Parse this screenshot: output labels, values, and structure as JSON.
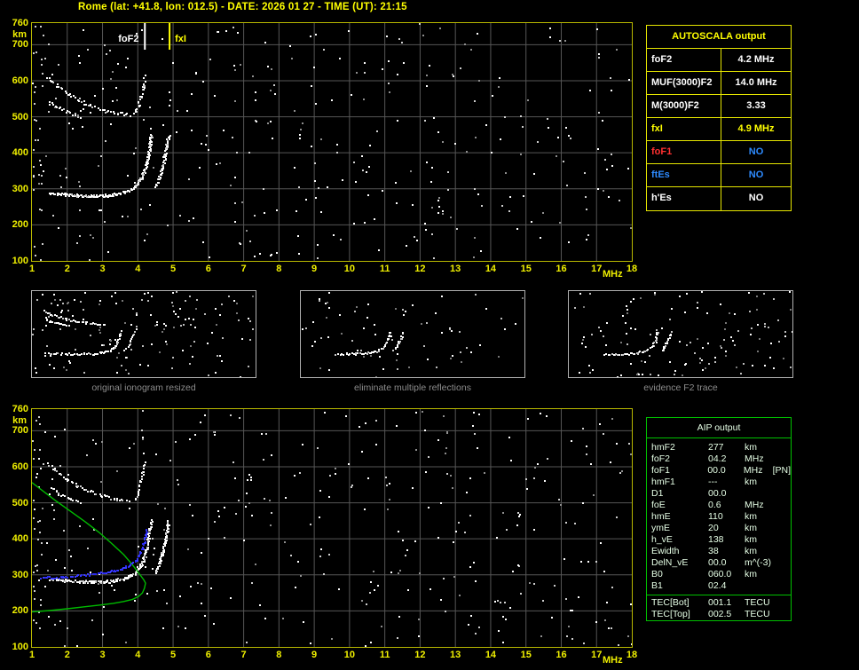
{
  "title": "Rome (lat: +41.8, lon: 012.5) - DATE: 2026 01 27 - TIME (UT): 21:15",
  "colors": {
    "background": "#000000",
    "title_text": "#ffff00",
    "plot_border": "#b8b800",
    "grid_line": "#565656",
    "axis_text": "#f0f000",
    "echo_trace": "#ffffff",
    "profile_green": "#00bb00",
    "restored_blue": "#3a3aff",
    "thumb_border": "#b0b0b0",
    "caption_text": "#8c8c8c",
    "autoscala_border": "#e6e600",
    "aip_border": "#00c000",
    "aip_text": "#e6ffe6"
  },
  "axis": {
    "y_ticks": [
      "760",
      "700",
      "600",
      "500",
      "400",
      "300",
      "200",
      "100"
    ],
    "y_unit": "km",
    "x_ticks": [
      "1",
      "2",
      "3",
      "4",
      "5",
      "6",
      "7",
      "8",
      "9",
      "10",
      "11",
      "12",
      "13",
      "14",
      "15",
      "16",
      "17",
      "18"
    ],
    "x_unit": "MHz"
  },
  "top_plot": {
    "markers": [
      {
        "label": "foF2",
        "freq": 4.2,
        "color": "#ffffff"
      },
      {
        "label": "fxI",
        "freq": 4.9,
        "color": "#ffff00"
      }
    ]
  },
  "autoscala_table": {
    "header": "AUTOSCALA output",
    "rows": [
      {
        "label": "foF2",
        "value": "4.2 MHz",
        "label_color": "#ffffff",
        "value_color": "#ffffff"
      },
      {
        "label": "MUF(3000)F2",
        "value": "14.0 MHz",
        "label_color": "#ffffff",
        "value_color": "#ffffff"
      },
      {
        "label": "M(3000)F2",
        "value": "3.33",
        "label_color": "#ffffff",
        "value_color": "#ffffff"
      },
      {
        "label": "fxI",
        "value": "4.9 MHz",
        "label_color": "#ffff00",
        "value_color": "#ffff00"
      },
      {
        "label": "foF1",
        "value": "NO",
        "label_color": "#ff3030",
        "value_color": "#2e8bff"
      },
      {
        "label": "ftEs",
        "value": "NO",
        "label_color": "#2e8bff",
        "value_color": "#2e8bff"
      },
      {
        "label": "h'Es",
        "value": "NO",
        "label_color": "#ffffff",
        "value_color": "#ffffff"
      }
    ]
  },
  "thumbnails": [
    {
      "caption": "original ionogram resized"
    },
    {
      "caption": "eliminate multiple reflections"
    },
    {
      "caption": "evidence F2 trace"
    }
  ],
  "aip_table": {
    "header": "AIP output",
    "rows": [
      {
        "label": "hmF2",
        "value": "277",
        "unit": "km",
        "extra": ""
      },
      {
        "label": "foF2",
        "value": "04.2",
        "unit": "MHz",
        "extra": ""
      },
      {
        "label": "foF1",
        "value": "00.0",
        "unit": "MHz",
        "extra": "[PN]"
      },
      {
        "label": "hmF1",
        "value": "---",
        "unit": "km",
        "extra": ""
      },
      {
        "label": "D1",
        "value": "00.0",
        "unit": "",
        "extra": ""
      },
      {
        "label": "foE",
        "value": "0.6",
        "unit": "MHz",
        "extra": ""
      },
      {
        "label": "hmE",
        "value": "110",
        "unit": "km",
        "extra": ""
      },
      {
        "label": "ymE",
        "value": "20",
        "unit": "km",
        "extra": ""
      },
      {
        "label": "h_vE",
        "value": "138",
        "unit": "km",
        "extra": ""
      },
      {
        "label": "Ewidth",
        "value": "38",
        "unit": "km",
        "extra": ""
      },
      {
        "label": "DelN_vE",
        "value": "00.0",
        "unit": "m^(-3)",
        "extra": ""
      },
      {
        "label": "B0",
        "value": "060.0",
        "unit": "km",
        "extra": ""
      },
      {
        "label": "B1",
        "value": "02.4",
        "unit": "",
        "extra": ""
      }
    ],
    "tec_rows": [
      {
        "label": "TEC[Bot]",
        "value": "001.1",
        "unit": "TECU",
        "extra": ""
      },
      {
        "label": "TEC[Top]",
        "value": "002.5",
        "unit": "TECU",
        "extra": ""
      }
    ]
  },
  "chart_data": {
    "type": "scatter",
    "xlabel": "MHz",
    "ylabel": "km",
    "x_range": [
      1,
      18
    ],
    "y_range": [
      100,
      760
    ],
    "key_values": {
      "foF2_MHz": 4.2,
      "fxI_MHz": 4.9,
      "MUF3000F2_MHz": 14.0,
      "M3000F2": 3.33,
      "hmF2_km": 277,
      "foE_MHz": 0.6,
      "hmE_km": 110,
      "B0_km": 60.0,
      "B1": 2.4,
      "TEC_bot_TECU": 1.1,
      "TEC_top_TECU": 2.5
    },
    "traces": {
      "f2_o_mode": [
        [
          1.5,
          290
        ],
        [
          1.9,
          286
        ],
        [
          2.3,
          283
        ],
        [
          2.7,
          282
        ],
        [
          3.05,
          283
        ],
        [
          3.35,
          286
        ],
        [
          3.6,
          292
        ],
        [
          3.8,
          300
        ],
        [
          3.95,
          312
        ],
        [
          4.07,
          328
        ],
        [
          4.16,
          348
        ],
        [
          4.23,
          372
        ],
        [
          4.29,
          400
        ],
        [
          4.33,
          428
        ],
        [
          4.37,
          452
        ]
      ],
      "f2_x_mode": [
        [
          4.5,
          310
        ],
        [
          4.6,
          335
        ],
        [
          4.68,
          362
        ],
        [
          4.75,
          392
        ],
        [
          4.81,
          422
        ],
        [
          4.86,
          448
        ]
      ],
      "second_hop_a": [
        [
          1.45,
          610
        ],
        [
          1.7,
          588
        ],
        [
          2.0,
          566
        ],
        [
          2.3,
          548
        ],
        [
          2.65,
          533
        ],
        [
          3.0,
          521
        ],
        [
          3.4,
          512
        ],
        [
          3.75,
          507
        ]
      ],
      "second_hop_b": [
        [
          1.5,
          545
        ],
        [
          1.75,
          527
        ],
        [
          2.05,
          512
        ],
        [
          2.35,
          500
        ]
      ],
      "second_hop_rise": [
        [
          3.9,
          510
        ],
        [
          4.0,
          535
        ],
        [
          4.08,
          562
        ],
        [
          4.14,
          590
        ],
        [
          4.19,
          615
        ]
      ]
    },
    "profile_green": {
      "topside": [
        [
          1.0,
          556
        ],
        [
          1.35,
          530
        ],
        [
          1.7,
          504
        ],
        [
          2.1,
          476
        ],
        [
          2.5,
          448
        ],
        [
          2.9,
          418
        ],
        [
          3.25,
          388
        ],
        [
          3.6,
          356
        ],
        [
          3.85,
          328
        ],
        [
          4.05,
          302
        ],
        [
          4.17,
          286
        ],
        [
          4.22,
          277
        ]
      ],
      "bottomside": [
        [
          4.22,
          277
        ],
        [
          4.19,
          263
        ],
        [
          4.13,
          250
        ],
        [
          4.02,
          240
        ],
        [
          3.85,
          232
        ],
        [
          3.6,
          226
        ],
        [
          3.3,
          221
        ],
        [
          2.9,
          216
        ],
        [
          2.45,
          211
        ],
        [
          2.0,
          206
        ],
        [
          1.5,
          201
        ],
        [
          1.0,
          197
        ]
      ]
    },
    "restored_trace_blue": [
      [
        1.25,
        293
      ],
      [
        1.55,
        294
      ],
      [
        1.85,
        296
      ],
      [
        2.15,
        298
      ],
      [
        2.45,
        301
      ],
      [
        2.75,
        304
      ],
      [
        3.05,
        308
      ],
      [
        3.3,
        313
      ],
      [
        3.55,
        320
      ],
      [
        3.75,
        329
      ],
      [
        3.9,
        341
      ],
      [
        4.02,
        356
      ],
      [
        4.1,
        373
      ],
      [
        4.16,
        392
      ],
      [
        4.2,
        412
      ],
      [
        4.23,
        428
      ]
    ]
  }
}
